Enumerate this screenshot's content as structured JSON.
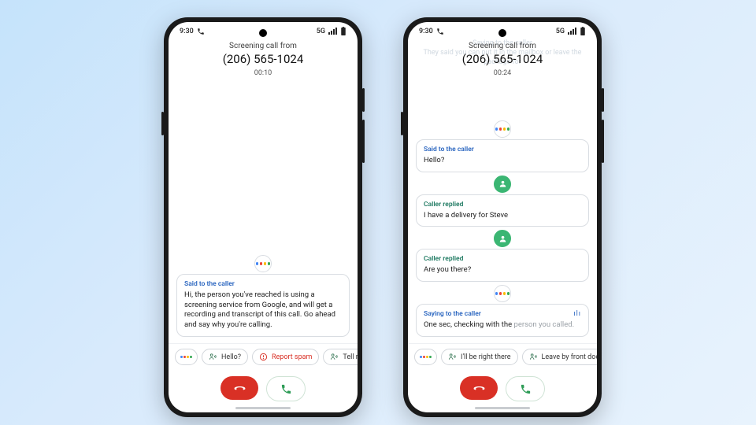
{
  "status": {
    "time": "9:30",
    "net": "5G"
  },
  "header": {
    "line1": "Screening call from",
    "phone": "(206) 565-1024"
  },
  "left": {
    "timer": "00:10",
    "card": {
      "title": "Said to the caller",
      "body": "Hi, the person you've reached is using a screening service from Google, and will get a recording and transcript of this call. Go ahead and say why you're calling."
    },
    "chips": {
      "hello": "Hello?",
      "spam": "Report spam",
      "tellme": "Tell me mo"
    }
  },
  "right": {
    "timer": "00:24",
    "ghost1": "Saying to the caller",
    "ghost2": "They said you can put it in the mailbox or leave the package for",
    "c1": {
      "title": "Said to the caller",
      "body": "Hello?"
    },
    "c2": {
      "title": "Caller replied",
      "body": "I have a delivery for Steve"
    },
    "c3": {
      "title": "Caller replied",
      "body": "Are you there?"
    },
    "c4": {
      "title": "Saying to the caller",
      "body_a": "One sec, checking with the ",
      "body_b": "person you called."
    },
    "chips": {
      "there": "I'll be right there",
      "door": "Leave by front door"
    }
  }
}
